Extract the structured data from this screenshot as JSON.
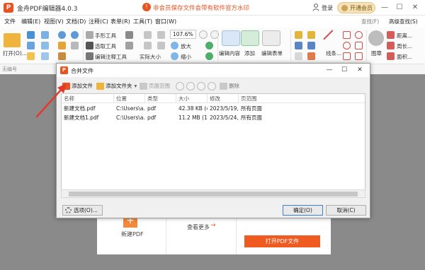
{
  "app": {
    "logo_glyph": "P",
    "title": "金舟PDF编辑器4.0.3",
    "promo_text": "非会员保存文件会带有软件官方水印",
    "promo_icon": "warning-circle-icon",
    "login_label": "登录",
    "vip_label": "开通会员",
    "window_controls": [
      "—",
      "☐",
      "✕"
    ]
  },
  "menu": {
    "items": [
      "文件",
      "编辑(E)",
      "视图(V)",
      "文档(D)",
      "注释(C)",
      "表单(R)",
      "工具(T)",
      "窗口(W)"
    ],
    "find_label": "查找(F)",
    "advanced_find_label": "高级查找(S)"
  },
  "ribbon": {
    "open_label": "打开(O)...",
    "hand_tool": "手形工具",
    "select_tool": "选取工具",
    "edit_annot_tool": "编辑注释工具",
    "actual_size": "实际大小",
    "zoom_value": "107.6%",
    "zoom_in": "放大",
    "zoom_out": "缩小",
    "edit_content": "编辑内容",
    "add": "添加",
    "edit_form": "编辑表单",
    "line_label": "线条...",
    "stamp": "图章",
    "distance": "距离...",
    "perimeter": "周长...",
    "area": "面积...",
    "blank_label": "无编号"
  },
  "document": {
    "new_pdf_label": "新建PDF",
    "new_pdf_glyph": "+",
    "see_more_label": "查看更多",
    "see_more_arrow": "→",
    "open_pdf_label": "打开PDF文件"
  },
  "dialog": {
    "icon_glyph": "P",
    "title": "合并文件",
    "controls": [
      "—",
      "☐",
      "✕"
    ],
    "toolbar": {
      "add_file": "添加文件",
      "add_folder": "添加文件夹",
      "page_range": "页面范围",
      "delete": "删除"
    },
    "table": {
      "headers": [
        "名称",
        "位置",
        "类型",
        "大小",
        "修改",
        "页范围"
      ],
      "rows": [
        [
          "新建文档.pdf",
          "C:\\Users\\a...",
          "pdf",
          "42.38 KB (4...",
          "2023/5/19,...",
          "所有页面"
        ],
        [
          "新建文档1.pdf",
          "C:\\Users\\a...",
          "pdf",
          "11.2 MB (1...",
          "2023/5/24,...",
          "所有页面"
        ]
      ]
    },
    "options_label": "选项(O)...",
    "ok_label": "确定(O)",
    "cancel_label": "取消(C)"
  },
  "colors": {
    "brand": "#e8531f",
    "accent_button": "#ee5a1f",
    "vip": "#f6e2b6",
    "annotation_arrow": "#e23a2b"
  }
}
